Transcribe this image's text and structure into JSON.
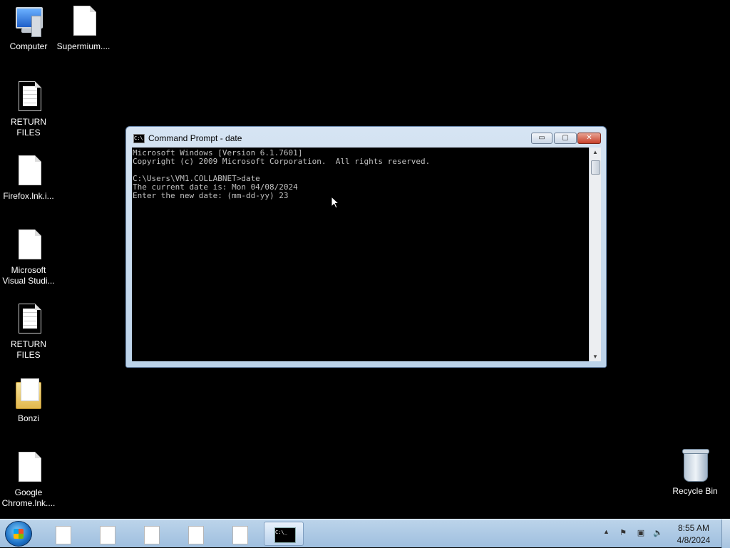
{
  "desktop": {
    "icons": [
      {
        "label": "Computer",
        "type": "computer-icon"
      },
      {
        "label": "Supermium....",
        "type": "file-icon"
      },
      {
        "label": "RETURN FILES",
        "type": "text-file-icon"
      },
      {
        "label": "Firefox.lnk.i...",
        "type": "file-icon"
      },
      {
        "label": "Microsoft\nVisual Studi...",
        "type": "file-icon"
      },
      {
        "label": "RETURN FILES",
        "type": "text-file-icon"
      },
      {
        "label": "Bonzi",
        "type": "folder-icon"
      },
      {
        "label": "Google\nChrome.lnk....",
        "type": "file-icon"
      },
      {
        "label": "Recycle Bin",
        "type": "recycle-bin-icon"
      }
    ]
  },
  "window": {
    "title": "Command Prompt - date",
    "icon_text": "C:\\",
    "console_lines": [
      "Microsoft Windows [Version 6.1.7601]",
      "Copyright (c) 2009 Microsoft Corporation.  All rights reserved.",
      "",
      "C:\\Users\\VM1.COLLABNET>date",
      "The current date is: Mon 04/08/2024",
      "Enter the new date: (mm-dd-yy) 23"
    ],
    "buttons": {
      "minimize": "▭",
      "maximize": "▢",
      "close": "✕"
    }
  },
  "taskbar": {
    "cmd_button_text": "C:\\_",
    "clock_time": "8:55 AM",
    "clock_date": "4/8/2024",
    "tray_up": "▲"
  },
  "colors": {
    "desktop_bg": "#000000",
    "console_text": "#c0c0c0",
    "close_button": "#c8402a"
  }
}
